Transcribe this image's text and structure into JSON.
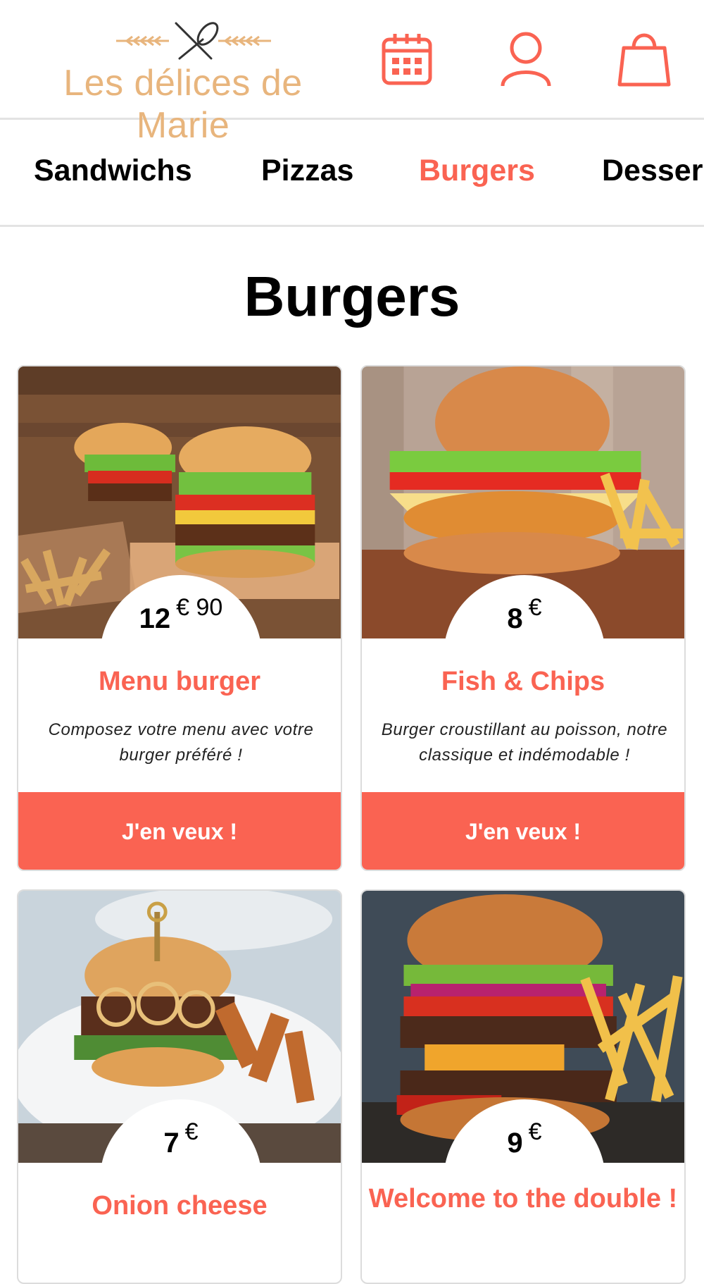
{
  "brand": {
    "name": "Les délices de Marie",
    "color": "#e8b57d"
  },
  "accent_color": "#fa6352",
  "header": {
    "icons": [
      "calendar-icon",
      "user-icon",
      "shopping-bag-icon"
    ]
  },
  "categories": [
    {
      "label": "Sandwichs",
      "active": false
    },
    {
      "label": "Pizzas",
      "active": false
    },
    {
      "label": "Burgers",
      "active": true
    },
    {
      "label": "Desser",
      "active": false
    }
  ],
  "page_title": "Burgers",
  "products": [
    {
      "price_int": "12",
      "price_sup": "€ 90",
      "name": "Menu burger",
      "description": "Composez votre menu avec votre burger préféré !",
      "button": "J'en veux !"
    },
    {
      "price_int": "8",
      "price_sup": "€",
      "name": "Fish & Chips",
      "description": "Burger croustillant au poisson, notre classique et indémodable !",
      "button": "J'en veux !"
    },
    {
      "price_int": "7",
      "price_sup": "€",
      "name": "Onion cheese",
      "description": "",
      "button": ""
    },
    {
      "price_int": "9",
      "price_sup": "€",
      "name": "Welcome to the double !",
      "description": "",
      "button": ""
    }
  ]
}
